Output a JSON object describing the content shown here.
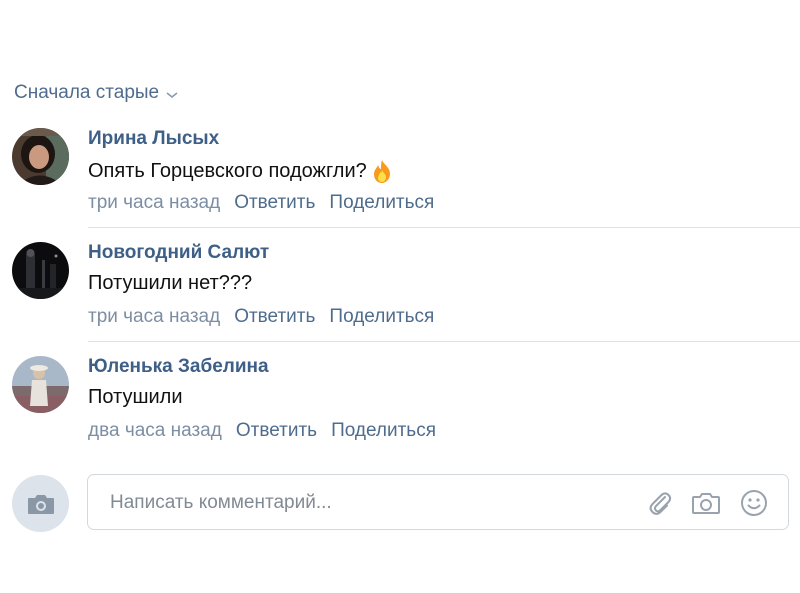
{
  "sort": {
    "label": "Сначала старые",
    "icon": "chevron-down-icon"
  },
  "comments": [
    {
      "author": "Ирина Лысых",
      "text": "Опять Горцевского подожгли?",
      "emoji": "fire-emoji",
      "time": "три часа назад",
      "reply_label": "Ответить",
      "share_label": "Поделиться",
      "avatar": "avatar-photo-woman-dark-hair"
    },
    {
      "author": "Новогодний Салют",
      "text": "Потушили нет???",
      "time": "три часа назад",
      "reply_label": "Ответить",
      "share_label": "Поделиться",
      "avatar": "avatar-photo-dark-night"
    },
    {
      "author": "Юленька Забелина",
      "text": "Потушили",
      "time": "два часа назад",
      "reply_label": "Ответить",
      "share_label": "Поделиться",
      "avatar": "avatar-photo-field-sky"
    }
  ],
  "composer": {
    "placeholder": "Написать комментарий...",
    "camera_icon": "camera-icon",
    "attach_icon": "paperclip-icon",
    "photo_icon": "camera-icon",
    "emoji_icon": "smiley-icon"
  },
  "colors": {
    "link": "#3e5f86",
    "action": "#4f6c8e",
    "muted": "#7c8ea3",
    "divider": "#dfe3e8",
    "icon": "#99a2ad"
  }
}
